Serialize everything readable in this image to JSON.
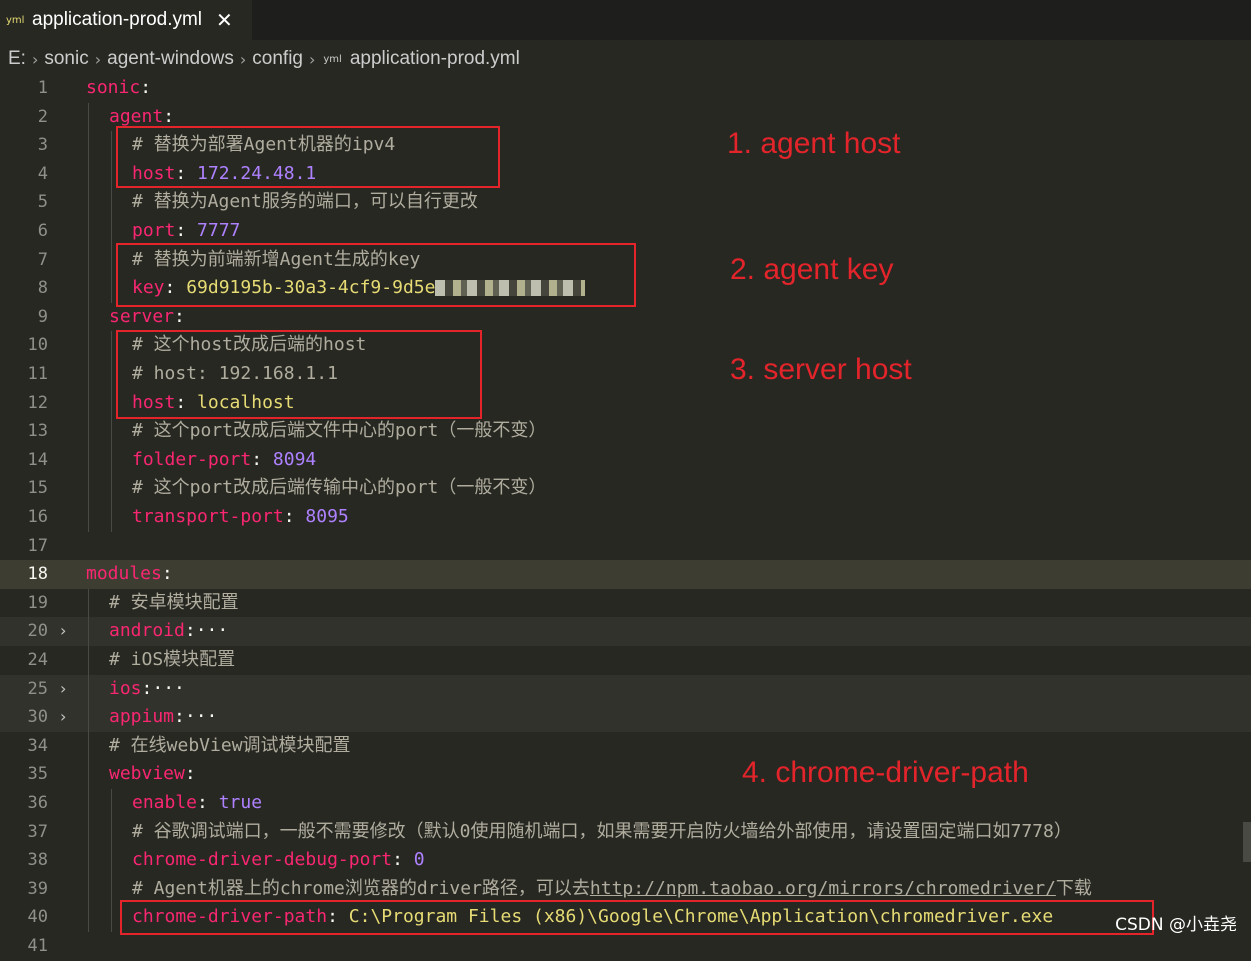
{
  "tab": {
    "icon_label": "yml",
    "filename": "application-prod.yml",
    "close_glyph": "✕"
  },
  "breadcrumb": {
    "items": [
      "E:",
      "sonic",
      "agent-windows",
      "config"
    ],
    "file_icon_label": "yml",
    "file": "application-prod.yml"
  },
  "annotations": [
    "1. agent host",
    "2. agent key",
    "3. server host",
    "4. chrome-driver-path"
  ],
  "watermark": "CSDN @小垚尧",
  "colors": {
    "background": "#272822",
    "key": "#f92672",
    "number": "#ae81ff",
    "string": "#e6db74",
    "comment": "#b0ad9f",
    "annotation": "#e3242b"
  },
  "lines": [
    {
      "n": "1",
      "indent": 0,
      "parts": [
        [
          "k",
          "sonic"
        ],
        [
          "p",
          ":"
        ]
      ]
    },
    {
      "n": "2",
      "indent": 1,
      "parts": [
        [
          "k",
          "agent"
        ],
        [
          "p",
          ":"
        ]
      ]
    },
    {
      "n": "3",
      "indent": 2,
      "parts": [
        [
          "c",
          "# 替换为部署Agent机器的ipv4"
        ]
      ]
    },
    {
      "n": "4",
      "indent": 2,
      "parts": [
        [
          "k",
          "host"
        ],
        [
          "p",
          ": "
        ],
        [
          "n",
          "172.24.48.1"
        ]
      ]
    },
    {
      "n": "5",
      "indent": 2,
      "parts": [
        [
          "c",
          "# 替换为Agent服务的端口，可以自行更改"
        ]
      ]
    },
    {
      "n": "6",
      "indent": 2,
      "parts": [
        [
          "k",
          "port"
        ],
        [
          "p",
          ": "
        ],
        [
          "n",
          "7777"
        ]
      ]
    },
    {
      "n": "7",
      "indent": 2,
      "parts": [
        [
          "c",
          "# 替换为前端新增Agent生成的key"
        ]
      ]
    },
    {
      "n": "8",
      "indent": 2,
      "parts": [
        [
          "k",
          "key"
        ],
        [
          "p",
          ": "
        ],
        [
          "s",
          "69d9195b-30a3-4cf9-9d5e"
        ],
        [
          "blur",
          ""
        ]
      ]
    },
    {
      "n": "9",
      "indent": 1,
      "parts": [
        [
          "k",
          "server"
        ],
        [
          "p",
          ":"
        ]
      ]
    },
    {
      "n": "10",
      "indent": 2,
      "parts": [
        [
          "c",
          "# 这个host改成后端的host"
        ]
      ]
    },
    {
      "n": "11",
      "indent": 2,
      "parts": [
        [
          "c",
          "# host: 192.168.1.1"
        ]
      ]
    },
    {
      "n": "12",
      "indent": 2,
      "parts": [
        [
          "k",
          "host"
        ],
        [
          "p",
          ": "
        ],
        [
          "s",
          "localhost"
        ]
      ]
    },
    {
      "n": "13",
      "indent": 2,
      "parts": [
        [
          "c",
          "# 这个port改成后端文件中心的port（一般不变）"
        ]
      ]
    },
    {
      "n": "14",
      "indent": 2,
      "parts": [
        [
          "k",
          "folder-port"
        ],
        [
          "p",
          ": "
        ],
        [
          "n",
          "8094"
        ]
      ]
    },
    {
      "n": "15",
      "indent": 2,
      "parts": [
        [
          "c",
          "# 这个port改成后端传输中心的port（一般不变）"
        ]
      ]
    },
    {
      "n": "16",
      "indent": 2,
      "parts": [
        [
          "k",
          "transport-port"
        ],
        [
          "p",
          ": "
        ],
        [
          "n",
          "8095"
        ]
      ]
    },
    {
      "n": "17",
      "indent": 0,
      "parts": []
    },
    {
      "n": "18",
      "indent": 0,
      "parts": [
        [
          "k",
          "modules"
        ],
        [
          "p",
          ":"
        ]
      ]
    },
    {
      "n": "19",
      "indent": 1,
      "parts": [
        [
          "c",
          "# 安卓模块配置"
        ]
      ]
    },
    {
      "n": "20",
      "indent": 1,
      "parts": [
        [
          "k",
          "android"
        ],
        [
          "p",
          ":"
        ],
        [
          "dots",
          "···"
        ]
      ]
    },
    {
      "n": "24",
      "indent": 1,
      "parts": [
        [
          "c",
          "# iOS模块配置"
        ]
      ]
    },
    {
      "n": "25",
      "indent": 1,
      "parts": [
        [
          "k",
          "ios"
        ],
        [
          "p",
          ":"
        ],
        [
          "dots",
          "···"
        ]
      ]
    },
    {
      "n": "30",
      "indent": 1,
      "parts": [
        [
          "k",
          "appium"
        ],
        [
          "p",
          ":"
        ],
        [
          "dots",
          "···"
        ]
      ]
    },
    {
      "n": "34",
      "indent": 1,
      "parts": [
        [
          "c",
          "# 在线webView调试模块配置"
        ]
      ]
    },
    {
      "n": "35",
      "indent": 1,
      "parts": [
        [
          "k",
          "webview"
        ],
        [
          "p",
          ":"
        ]
      ]
    },
    {
      "n": "36",
      "indent": 2,
      "parts": [
        [
          "k",
          "enable"
        ],
        [
          "p",
          ": "
        ],
        [
          "n",
          "true"
        ]
      ]
    },
    {
      "n": "37",
      "indent": 2,
      "parts": [
        [
          "c",
          "# 谷歌调试端口，一般不需要修改（默认0使用随机端口，如果需要开启防火墙给外部使用，请设置固定端口如7778）"
        ]
      ]
    },
    {
      "n": "38",
      "indent": 2,
      "parts": [
        [
          "k",
          "chrome-driver-debug-port"
        ],
        [
          "p",
          ": "
        ],
        [
          "n",
          "0"
        ]
      ]
    },
    {
      "n": "39",
      "indent": 2,
      "parts": [
        [
          "c",
          "# Agent机器上的chrome浏览器的driver路径，可以去"
        ],
        [
          "url",
          "http://npm.taobao.org/mirrors/chromedriver/"
        ],
        [
          "c",
          "下载"
        ]
      ]
    },
    {
      "n": "40",
      "indent": 2,
      "parts": [
        [
          "k",
          "chrome-driver-path"
        ],
        [
          "p",
          ": "
        ],
        [
          "s",
          "C:\\Program Files (x86)\\Google\\Chrome\\Application\\chromedriver.exe"
        ]
      ]
    },
    {
      "n": "41",
      "indent": 0,
      "parts": []
    }
  ]
}
